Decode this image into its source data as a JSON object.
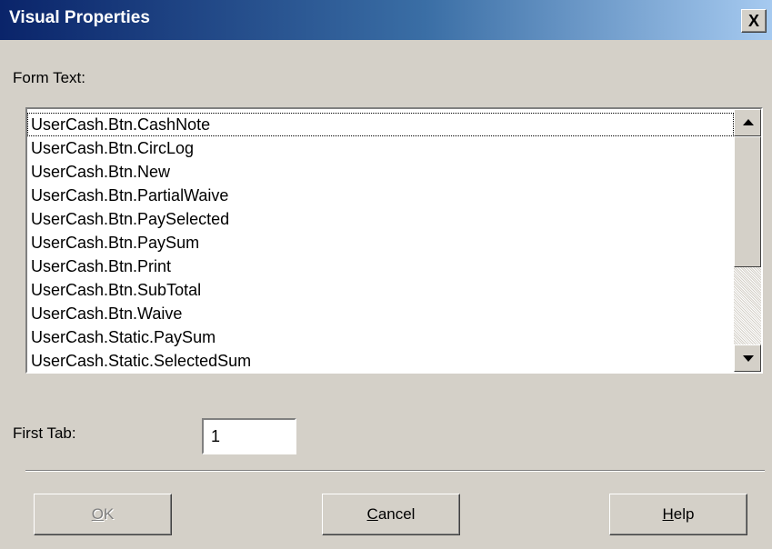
{
  "window": {
    "title": "Visual Properties",
    "close_label": "X"
  },
  "form_text": {
    "label": "Form Text:",
    "items": [
      "UserCash.Btn.CashNote",
      "UserCash.Btn.CircLog",
      "UserCash.Btn.New",
      "UserCash.Btn.PartialWaive",
      "UserCash.Btn.PaySelected",
      "UserCash.Btn.PaySum",
      "UserCash.Btn.Print",
      "UserCash.Btn.SubTotal",
      "UserCash.Btn.Waive",
      "UserCash.Static.PaySum",
      "UserCash.Static.SelectedSum"
    ],
    "focused_index": 0
  },
  "first_tab": {
    "label": "First Tab:",
    "value": "1"
  },
  "buttons": {
    "ok": {
      "mnemonic": "O",
      "rest": "K",
      "enabled": false
    },
    "cancel": {
      "mnemonic": "C",
      "rest": "ancel"
    },
    "help": {
      "mnemonic": "H",
      "rest": "elp"
    }
  }
}
